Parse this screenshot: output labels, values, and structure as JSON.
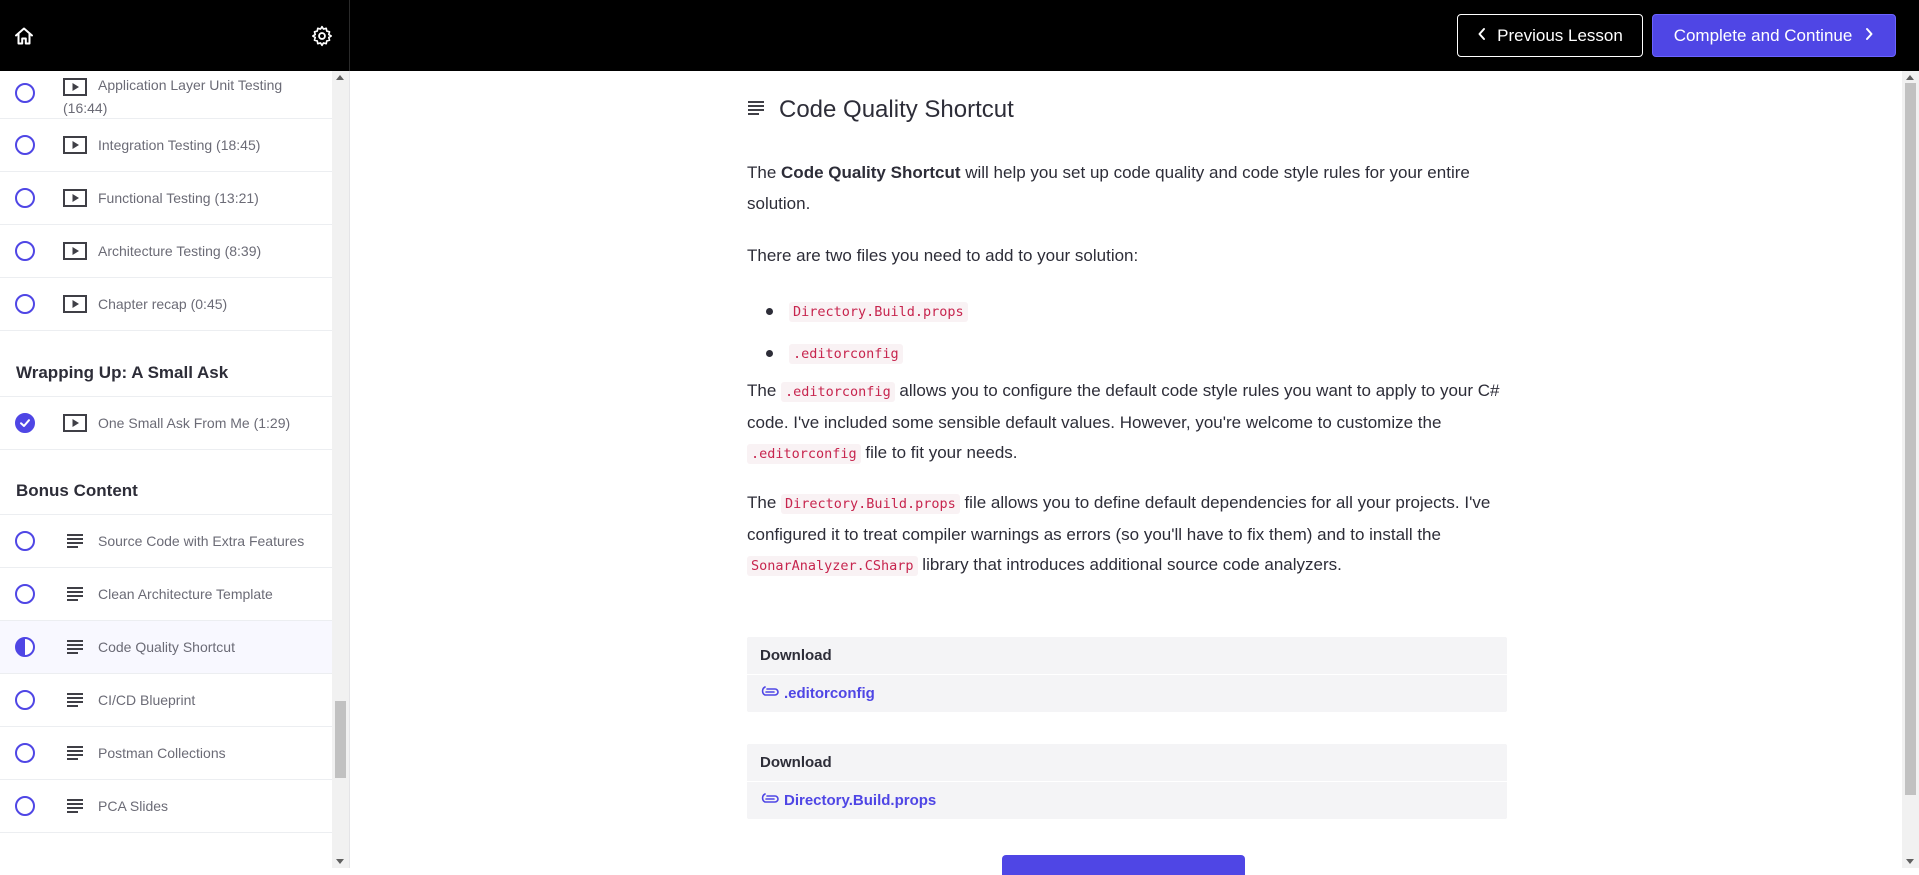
{
  "topbar": {
    "prev_label": "Previous Lesson",
    "next_label": "Complete and Continue",
    "accent_color": "#4f46e5"
  },
  "sidebar": {
    "lessons_top": [
      {
        "title": "Application Layer Unit Testing",
        "title_line2": "(16:44)",
        "type": "video",
        "status": "incomplete"
      },
      {
        "title": "Integration Testing (18:45)",
        "type": "video",
        "status": "incomplete"
      },
      {
        "title": "Functional Testing (13:21)",
        "type": "video",
        "status": "incomplete"
      },
      {
        "title": "Architecture Testing (8:39)",
        "type": "video",
        "status": "incomplete"
      },
      {
        "title": "Chapter recap (0:45)",
        "type": "video",
        "status": "incomplete"
      }
    ],
    "chapter_wrapping": "Wrapping Up: A Small Ask",
    "lessons_wrapping": [
      {
        "title": "One Small Ask From Me (1:29)",
        "type": "video",
        "status": "complete"
      }
    ],
    "chapter_bonus": "Bonus Content",
    "lessons_bonus": [
      {
        "title": "Source Code with Extra Features",
        "type": "text",
        "status": "incomplete"
      },
      {
        "title": "Clean Architecture Template",
        "type": "text",
        "status": "incomplete"
      },
      {
        "title": "Code Quality Shortcut",
        "type": "text",
        "status": "current"
      },
      {
        "title": "CI/CD Blueprint",
        "type": "text",
        "status": "incomplete"
      },
      {
        "title": "Postman Collections",
        "type": "text",
        "status": "incomplete"
      },
      {
        "title": "PCA Slides",
        "type": "text",
        "status": "incomplete"
      }
    ]
  },
  "main": {
    "title": "Code Quality Shortcut",
    "p1_pre": "The ",
    "p1_bold": "Code Quality Shortcut",
    "p1_post": " will help you set up code quality and code style rules for your entire solution.",
    "p2": "There are two files you need to add to your solution:",
    "bullet_1": "Directory.Build.props",
    "bullet_2": ".editorconfig",
    "p3_a": "The ",
    "p3_code": ".editorconfig",
    "p3_b": " allows you to configure the default code style rules you want to apply to your C# code. I've included some sensible default values. However, you're welcome to customize the ",
    "p3_code2": ".editorconfig",
    "p3_c": " file to fit your needs.",
    "p4_a": "The ",
    "p4_code": "Directory.Build.props",
    "p4_b": " file allows you to define default dependencies for all your projects. I've configured it to treat compiler warnings as errors (so you'll have to fix them) and to install the ",
    "p4_code2": "SonarAnalyzer.CSharp",
    "p4_c": " library that introduces additional source code analyzers.",
    "downloads": [
      {
        "heading": "Download",
        "file": ".editorconfig"
      },
      {
        "heading": "Download",
        "file": "Directory.Build.props"
      }
    ]
  }
}
